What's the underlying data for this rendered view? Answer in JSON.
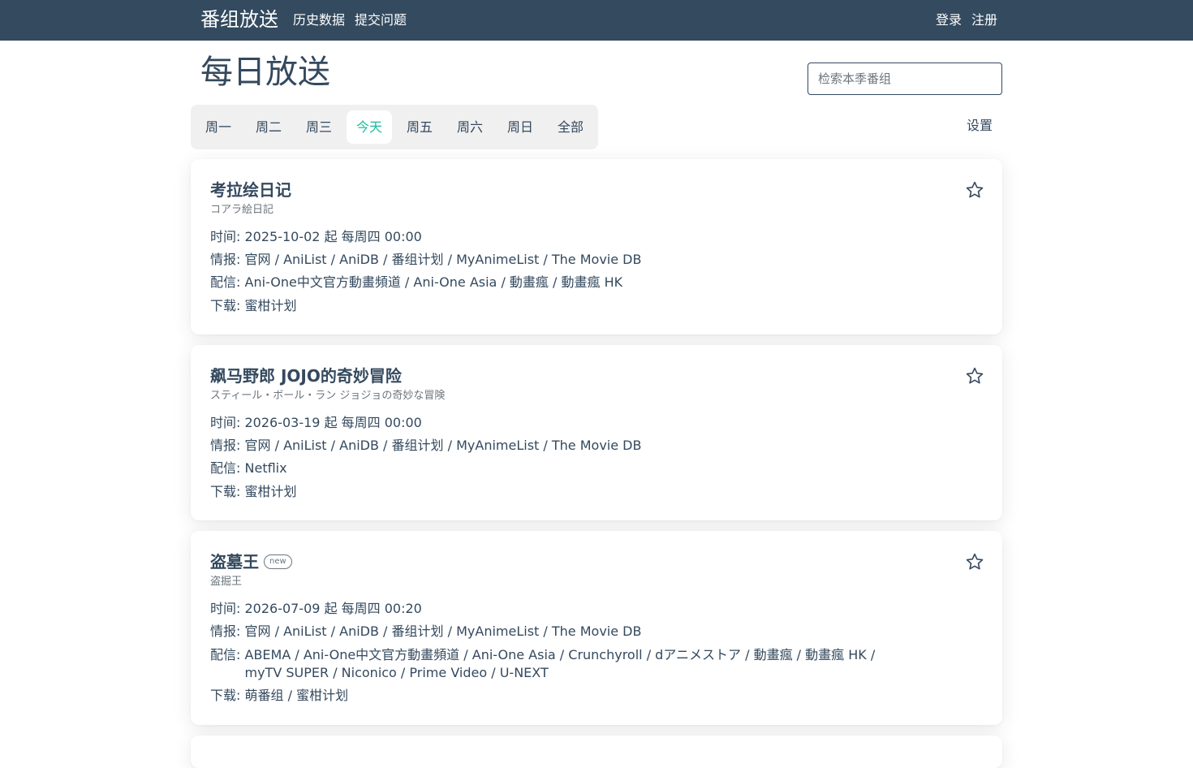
{
  "navbar": {
    "brand": "番组放送",
    "links": [
      "历史数据",
      "提交问题"
    ],
    "login": "登录",
    "register": "注册"
  },
  "page": {
    "title": "每日放送",
    "search_placeholder": "检索本季番组",
    "settings": "设置"
  },
  "tabs": [
    {
      "label": "周一",
      "active": false
    },
    {
      "label": "周二",
      "active": false
    },
    {
      "label": "周三",
      "active": false
    },
    {
      "label": "今天",
      "active": true
    },
    {
      "label": "周五",
      "active": false
    },
    {
      "label": "周六",
      "active": false
    },
    {
      "label": "周日",
      "active": false
    },
    {
      "label": "全部",
      "active": false
    }
  ],
  "labels": {
    "time": "时间:",
    "info": "情报:",
    "stream": "配信:",
    "download": "下载:",
    "separator": " / "
  },
  "colors": {
    "navbar": "#334a5f",
    "text": "#34495e",
    "accent": "#1abc9c",
    "muted": "#6c757d"
  },
  "shows": [
    {
      "title": "考拉绘日记",
      "subtitle": "コアラ絵日記",
      "badge": "",
      "time": "2025-10-02 起 每周四 00:00",
      "info": [
        "官网",
        "AniList",
        "AniDB",
        "番组计划",
        "MyAnimeList",
        "The Movie DB"
      ],
      "stream_lines": [
        [
          "Ani-One中文官方動畫頻道",
          "Ani-One Asia",
          "動畫瘋",
          "動畫瘋 HK"
        ]
      ],
      "download": [
        "蜜柑计划"
      ]
    },
    {
      "title": "飙马野郎 JOJO的奇妙冒险",
      "subtitle": "スティール・ボール・ラン ジョジョの奇妙な冒険",
      "badge": "",
      "time": "2026-03-19 起 每周四 00:00",
      "info": [
        "官网",
        "AniList",
        "AniDB",
        "番组计划",
        "MyAnimeList",
        "The Movie DB"
      ],
      "stream_lines": [
        [
          "Netflix"
        ]
      ],
      "download": [
        "蜜柑计划"
      ]
    },
    {
      "title": "盗墓王",
      "subtitle": "盗掘王",
      "badge": "new",
      "time": "2026-07-09 起 每周四 00:20",
      "info": [
        "官网",
        "AniList",
        "AniDB",
        "番组计划",
        "MyAnimeList",
        "The Movie DB"
      ],
      "stream_lines": [
        [
          "ABEMA",
          "Ani-One中文官方動畫頻道",
          "Ani-One Asia",
          "Crunchyroll",
          "dアニメストア",
          "動畫瘋",
          "動畫瘋 HK /"
        ],
        [
          "myTV SUPER",
          "Niconico",
          "Prime Video",
          "U-NEXT"
        ]
      ],
      "download": [
        "萌番组",
        "蜜柑计划"
      ]
    }
  ]
}
